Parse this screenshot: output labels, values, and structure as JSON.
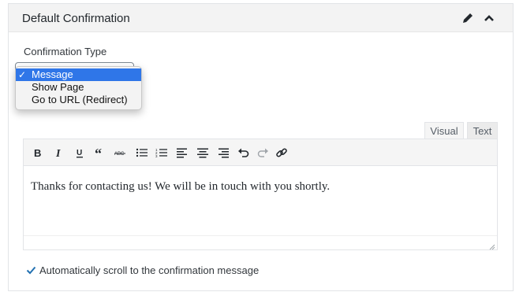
{
  "panel": {
    "title": "Default Confirmation",
    "edit_icon": "pencil-icon",
    "collapse_icon": "chevron-up-icon"
  },
  "confirmation_type": {
    "label": "Confirmation Type",
    "selected": "Message",
    "options": [
      "Message",
      "Show Page",
      "Go to URL (Redirect)"
    ],
    "check_mark": "✓"
  },
  "editor": {
    "tabs": [
      "Visual",
      "Text"
    ],
    "active_tab": "Visual",
    "toolbar": [
      "bold-icon",
      "italic-icon",
      "underline-icon",
      "blockquote-icon",
      "strikethrough-icon",
      "bulleted-list-icon",
      "numbered-list-icon",
      "align-left-icon",
      "align-center-icon",
      "align-right-icon",
      "undo-icon",
      "redo-icon",
      "link-icon"
    ],
    "content": "Thanks for contacting us! We will be in touch with you shortly."
  },
  "auto_scroll": {
    "label": "Automatically scroll to the confirmation message",
    "checked": true
  },
  "colors": {
    "accent": "#2f76e8",
    "header_bg": "#f3f3f3",
    "checkbox": "#2271b1"
  }
}
